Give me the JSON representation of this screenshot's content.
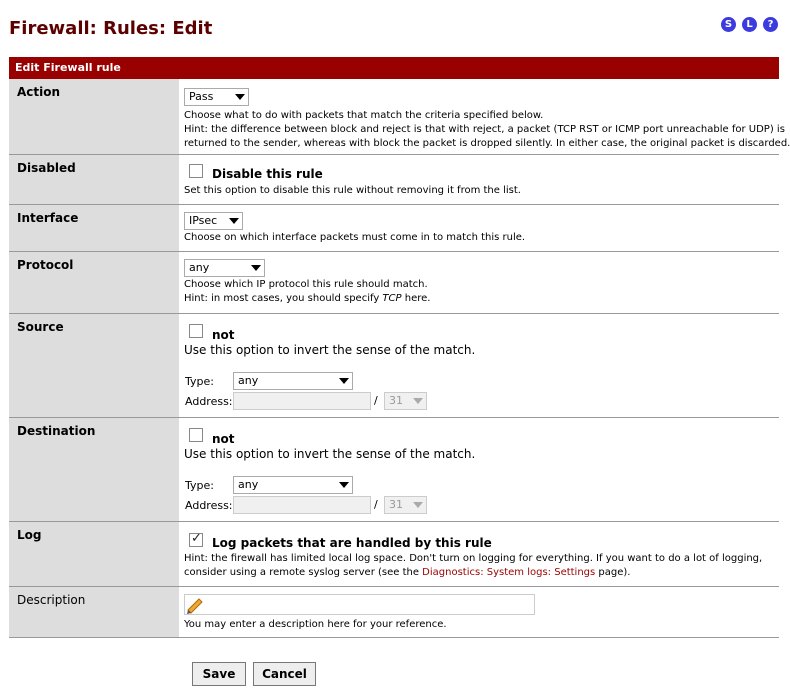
{
  "page_title": "Firewall: Rules: Edit",
  "top_icons": [
    "S",
    "L",
    "?"
  ],
  "table_header": "Edit Firewall rule",
  "action": {
    "label": "Action",
    "selected": "Pass",
    "hint_1": "Choose what to do with packets that match the criteria specified below.",
    "hint_2": "Hint: the difference between block and reject is that with reject, a packet (TCP RST or ICMP port unreachable for UDP) is",
    "hint_3": "returned to the sender, whereas with block the packet is dropped silently. In either case, the original packet is discarded."
  },
  "disabled": {
    "label": "Disabled",
    "checkbox_label": "Disable this rule",
    "checked": false,
    "hint": "Set this option to disable this rule without removing it from the list."
  },
  "interface": {
    "label": "Interface",
    "selected": "IPsec",
    "hint": "Choose on which interface packets must come in to match this rule."
  },
  "protocol": {
    "label": "Protocol",
    "selected": "any",
    "hint_1": "Choose which IP protocol this rule should match.",
    "hint_2_prefix": "Hint: in most cases, you should specify ",
    "hint_2_em": "TCP",
    "hint_2_suffix": " here."
  },
  "source": {
    "label": "Source",
    "not_label": "not",
    "hint": "Use this option to invert the sense of the match.",
    "type_label": "Type:",
    "type_selected": "any",
    "address_label": "Address:",
    "address_value": "",
    "slash": "/",
    "mask": "31"
  },
  "destination": {
    "label": "Destination",
    "not_label": "not",
    "hint": "Use this option to invert the sense of the match.",
    "type_label": "Type:",
    "type_selected": "any",
    "address_label": "Address:",
    "address_value": "",
    "slash": "/",
    "mask": "31"
  },
  "log": {
    "label": "Log",
    "checkbox_label": "Log packets that are handled by this rule",
    "checked": true,
    "hint_1": "Hint: the firewall has limited local log space. Don't turn on logging for everything. If you want to do a lot of logging,",
    "hint_2_prefix": "consider using a remote syslog server (see the ",
    "hint_2_link": "Diagnostics: System logs: Settings",
    "hint_2_suffix": " page)."
  },
  "description": {
    "label": "Description",
    "value": "",
    "hint": "You may enter a description here for your reference."
  },
  "buttons": {
    "save": "Save",
    "cancel": "Cancel"
  }
}
